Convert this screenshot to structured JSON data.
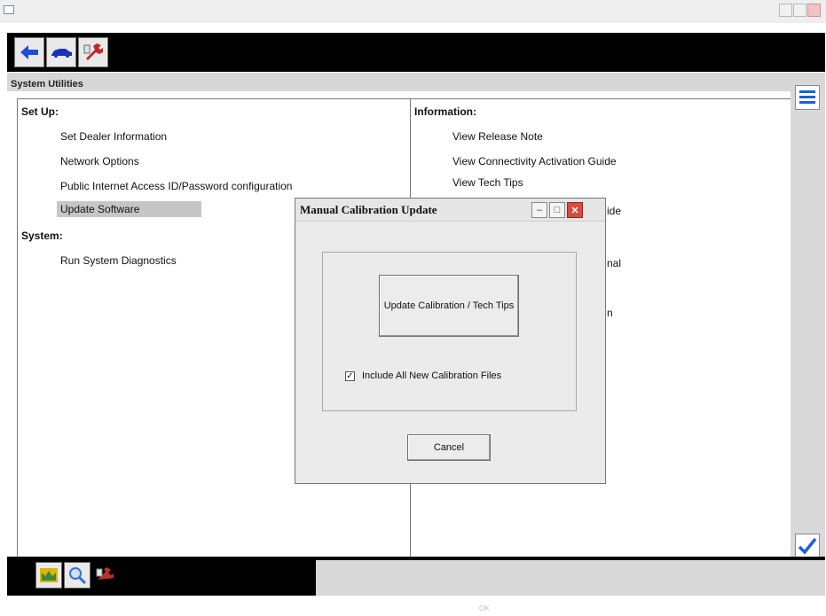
{
  "window": {
    "title": "",
    "controls": [
      "minimize",
      "maximize",
      "close"
    ]
  },
  "toolbar_top": {
    "buttons": [
      {
        "name": "back-button",
        "icon": "left-arrow-icon",
        "color": "#1f4fd6"
      },
      {
        "name": "vehicle-button",
        "icon": "car-icon",
        "color": "#1a33b8"
      },
      {
        "name": "tools-button",
        "icon": "wrench-icon",
        "color": "#c0282c"
      }
    ]
  },
  "section_title": "System Utilities",
  "left_panel": {
    "setup_heading": "Set Up:",
    "setup_items": [
      "Set Dealer Information",
      "Network Options",
      "Public Internet Access ID/Password configuration",
      "Update Software"
    ],
    "selected_item": "Update Software",
    "system_heading": "System:",
    "system_items": [
      "Run System Diagnostics"
    ]
  },
  "right_panel": {
    "info_heading": "Information:",
    "info_items": [
      "View Release Note",
      "View Connectivity Activation Guide",
      "View Tech Tips"
    ],
    "partial_fragments": [
      "ide",
      "nal",
      "n"
    ]
  },
  "dialog": {
    "title": "Manual Calibration Update",
    "update_button": "Update Calibration / Tech Tips",
    "checkbox_label": "Include All New Calibration Files",
    "checkbox_checked": true,
    "cancel_button": "Cancel"
  },
  "side_buttons": [
    {
      "name": "list-button",
      "icon": "list-icon",
      "color": "#1f5fd6"
    },
    {
      "name": "confirm-button",
      "icon": "checkmark-icon",
      "color": "#1f5fd6"
    }
  ],
  "toolbar_bottom": {
    "buttons": [
      {
        "name": "home-button",
        "icon": "home-icon",
        "color": "#e1b400"
      },
      {
        "name": "search-button",
        "icon": "magnifier-icon",
        "color": "#3a6fd6"
      },
      {
        "name": "settings-button",
        "icon": "tools-icon",
        "color": "#b8322c"
      }
    ]
  },
  "statusbar": {
    "text": [
      "OK"
    ]
  }
}
